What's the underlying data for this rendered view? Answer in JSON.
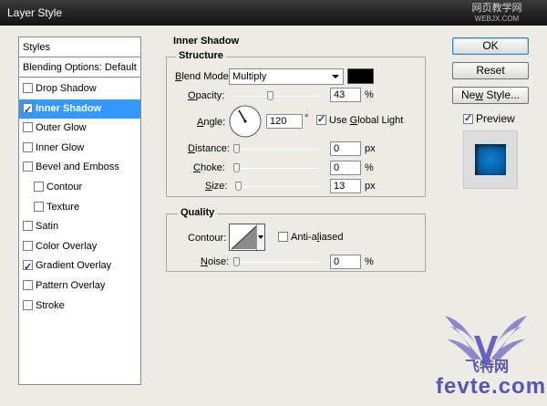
{
  "window": {
    "title": "Layer Style"
  },
  "watermark": {
    "top_line": "网页教学网",
    "top_sub": "WEBJX.COM",
    "bottom_cn": "飞特网",
    "bottom_en": "fevte.com"
  },
  "styles_list": {
    "header": "Styles",
    "blending": "Blending Options: Default",
    "items": [
      {
        "label": "Drop Shadow",
        "checked": false,
        "selected": false,
        "sub": false
      },
      {
        "label": "Inner Shadow",
        "checked": true,
        "selected": true,
        "sub": false
      },
      {
        "label": "Outer Glow",
        "checked": false,
        "selected": false,
        "sub": false
      },
      {
        "label": "Inner Glow",
        "checked": false,
        "selected": false,
        "sub": false
      },
      {
        "label": "Bevel and Emboss",
        "checked": false,
        "selected": false,
        "sub": false
      },
      {
        "label": "Contour",
        "checked": false,
        "selected": false,
        "sub": true
      },
      {
        "label": "Texture",
        "checked": false,
        "selected": false,
        "sub": true
      },
      {
        "label": "Satin",
        "checked": false,
        "selected": false,
        "sub": false
      },
      {
        "label": "Color Overlay",
        "checked": false,
        "selected": false,
        "sub": false
      },
      {
        "label": "Gradient Overlay",
        "checked": true,
        "selected": false,
        "sub": false
      },
      {
        "label": "Pattern Overlay",
        "checked": false,
        "selected": false,
        "sub": false
      },
      {
        "label": "Stroke",
        "checked": false,
        "selected": false,
        "sub": false
      }
    ]
  },
  "panel": {
    "title": "Inner Shadow",
    "structure": {
      "title": "Structure",
      "blend_mode": {
        "pre": "",
        "u": "B",
        "post": "lend Mode:",
        "value": "Multiply",
        "color": "#000000"
      },
      "opacity": {
        "pre": "",
        "u": "O",
        "post": "pacity:",
        "value": "43",
        "unit": "%",
        "fraction": 0.43
      },
      "angle": {
        "pre": "",
        "u": "A",
        "post": "ngle:",
        "value": "120",
        "unit": "°",
        "degrees": 120
      },
      "use_global_light": {
        "pre": "Use ",
        "u": "G",
        "post": "lobal Light",
        "checked": true
      },
      "distance": {
        "pre": "",
        "u": "D",
        "post": "istance:",
        "value": "0",
        "unit": "px",
        "fraction": 0.0
      },
      "choke": {
        "pre": "",
        "u": "C",
        "post": "hoke:",
        "value": "0",
        "unit": "%",
        "fraction": 0.0
      },
      "size": {
        "pre": "",
        "u": "S",
        "post": "ize:",
        "value": "13",
        "unit": "px",
        "fraction": 0.052
      }
    },
    "quality": {
      "title": "Quality",
      "contour": {
        "label": "Contour:"
      },
      "anti_aliased": {
        "pre": "Anti-a",
        "u": "l",
        "post": "iased",
        "checked": false
      },
      "noise": {
        "pre": "",
        "u": "N",
        "post": "oise:",
        "value": "0",
        "unit": "%",
        "fraction": 0.0
      }
    }
  },
  "buttons": {
    "ok": "OK",
    "reset": "Reset",
    "new_style": {
      "pre": "Ne",
      "u": "w",
      "post": " Style..."
    }
  },
  "preview": {
    "label": "Preview",
    "checked": true,
    "swatch_color": "#0b6bb8"
  }
}
